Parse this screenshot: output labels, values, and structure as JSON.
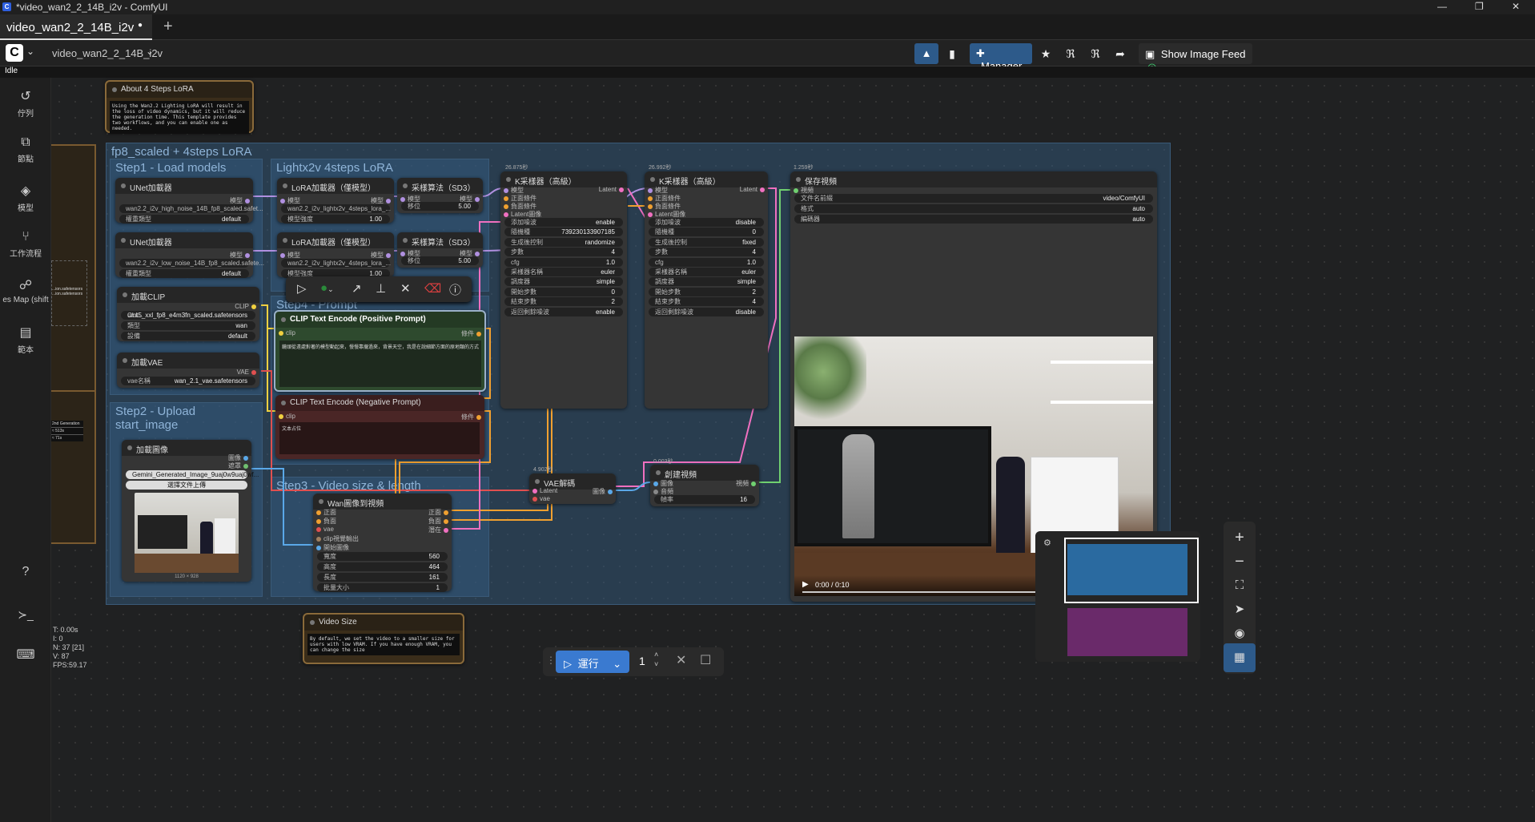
{
  "window": {
    "title": "*video_wan2_2_14B_i2v - ComfyUI",
    "min": "—",
    "max": "❐",
    "close": "✕"
  },
  "tabs": [
    {
      "label": "video_wan2_2_14B_i2v",
      "dot": "●"
    }
  ],
  "tab_add": "+",
  "toolbar": {
    "workflow_name": "video_wan2_2_14B_i2v",
    "manager": "Manager",
    "show_image_feed": "Show Image Feed"
  },
  "status": "Idle",
  "sidebar": [
    {
      "icon": "history-icon",
      "glyph": "↺",
      "label": "佇列"
    },
    {
      "icon": "node-icon",
      "glyph": "⧉",
      "label": "節點"
    },
    {
      "icon": "model-icon",
      "glyph": "◈",
      "label": "模型"
    },
    {
      "icon": "workflow-icon",
      "glyph": "⑂",
      "label": "工作流程"
    },
    {
      "icon": "map-icon",
      "glyph": "☍",
      "label": "es Map (shift"
    },
    {
      "icon": "template-icon",
      "glyph": "▤",
      "label": "範本"
    }
  ],
  "sidebar_bottom": {
    "help": "?",
    "terminal": "≻_",
    "keyboard": "⌨"
  },
  "stats": [
    "T: 0.00s",
    "I: 0",
    "N: 37 [21]",
    "V: 87",
    "FPS:59.17"
  ],
  "notes": {
    "about": {
      "title": "About 4 Steps LoRA",
      "text": "Using the Wan2.2 Lighting LoRA will result in the loss of video dynamics, but it will reduce the generation time. This template provides two workflows, and you can enable one as needed."
    },
    "video_size": {
      "title": "Video Size",
      "text": "By default, we set the video to a smaller size for users with low VRAM. If you have enough VRAM, you can change the size"
    }
  },
  "partial_left": {
    "line1": "...ion.safetensors",
    "line2": "...ion.safetensors",
    "table_header": "2nd Generation",
    "row1": "≈ 513s",
    "row2": "≈ 71s"
  },
  "groups": {
    "main": "fp8_scaled + 4steps LoRA",
    "step1": "Step1 - Load models",
    "lightx": "Lightx2v 4steps LoRA",
    "step4": "Step4 - Prompt",
    "step2": "Step2 - Upload start_image",
    "step3": "Step3 - Video size & length"
  },
  "nodes": {
    "unet1": {
      "title": "UNet加載器",
      "out": "模型",
      "w1": "wan2.2_i2v_high_noise_14B_fp8_scaled.safet...",
      "w2k": "權重類型",
      "w2v": "default"
    },
    "unet2": {
      "title": "UNet加載器",
      "out": "模型",
      "w1": "wan2.2_i2v_low_noise_14B_fp8_scaled.safete...",
      "w2k": "權重類型",
      "w2v": "default"
    },
    "clip": {
      "title": "加載CLIP",
      "out": "CLIP",
      "w1k": "CLI...",
      "w1v": "umt5_xxl_fp8_e4m3fn_scaled.safetensors",
      "w2k": "類型",
      "w2v": "wan",
      "w3k": "設備",
      "w3v": "default"
    },
    "vae": {
      "title": "加載VAE",
      "out": "VAE",
      "w1k": "vae名稱",
      "w1v": "wan_2.1_vae.safetensors"
    },
    "lora1": {
      "title": "LoRA加載器（僅模型）",
      "in": "模型",
      "out": "模型",
      "w1": "wan2.2_i2v_lightx2v_4steps_lora_...",
      "w2k": "模型強度",
      "w2v": "1.00"
    },
    "lora2": {
      "title": "LoRA加載器（僅模型）",
      "in": "模型",
      "out": "模型",
      "w1": "wan2.2_i2v_lightx2v_4steps_lora_...",
      "w2k": "模型強度",
      "w2v": "1.00"
    },
    "sd3a": {
      "title": "采樣算法（SD3）",
      "in": "模型",
      "out": "模型",
      "wk": "移位",
      "wv": "5.00"
    },
    "sd3b": {
      "title": "采樣算法（SD3）",
      "in": "模型",
      "out": "模型",
      "wk": "移位",
      "wv": "5.00"
    },
    "pos": {
      "title": "CLIP Text Encode (Positive Prompt)",
      "in": "clip",
      "out": "條件",
      "text": "鏡頭從遠處對著的模型動起來，慢慢靠攏過來，背景天空，我是在說細節方面的原地類的方式"
    },
    "neg": {
      "title": "CLIP Text Encode (Negative Prompt)",
      "in": "clip",
      "out": "條件",
      "text": "文本占位"
    },
    "loadimg": {
      "title": "加載圖像",
      "out1": "圖像",
      "out2": "遮罩",
      "file": "Gemini_Generated_Image_9uaj0w9uaj0wf...",
      "upload": "選擇文件上傳",
      "size": "1120 × 928"
    },
    "wanimg": {
      "title": "Wan圖像到視頻",
      "in": [
        "正面",
        "負面",
        "vae",
        "clip視覺輸出",
        "開始圖像"
      ],
      "out": [
        "正面",
        "負面",
        "潛在"
      ],
      "w": [
        {
          "k": "寬度",
          "v": "560"
        },
        {
          "k": "高度",
          "v": "464"
        },
        {
          "k": "長度",
          "v": "161"
        },
        {
          "k": "批量大小",
          "v": "1"
        }
      ]
    },
    "k1": {
      "time": "26.875秒",
      "title": "K采樣器（高級）",
      "in": [
        "模型",
        "正面條件",
        "負面條件",
        "Latent圖像"
      ],
      "out": "Latent",
      "w": [
        {
          "k": "添加噪波",
          "v": "enable"
        },
        {
          "k": "隨機種",
          "v": "739230133907185"
        },
        {
          "k": "生成後控制",
          "v": "randomize"
        },
        {
          "k": "步數",
          "v": "4"
        },
        {
          "k": "cfg",
          "v": "1.0"
        },
        {
          "k": "采樣器名稱",
          "v": "euler"
        },
        {
          "k": "調度器",
          "v": "simple"
        },
        {
          "k": "開始步數",
          "v": "0"
        },
        {
          "k": "結束步數",
          "v": "2"
        },
        {
          "k": "返回剩餘噪波",
          "v": "enable"
        }
      ]
    },
    "k2": {
      "time": "26.992秒",
      "title": "K采樣器（高級）",
      "in": [
        "模型",
        "正面條件",
        "負面條件",
        "Latent圖像"
      ],
      "out": "Latent",
      "w": [
        {
          "k": "添加噪波",
          "v": "disable"
        },
        {
          "k": "隨機種",
          "v": "0"
        },
        {
          "k": "生成後控制",
          "v": "fixed"
        },
        {
          "k": "步數",
          "v": "4"
        },
        {
          "k": "cfg",
          "v": "1.0"
        },
        {
          "k": "采樣器名稱",
          "v": "euler"
        },
        {
          "k": "調度器",
          "v": "simple"
        },
        {
          "k": "開始步數",
          "v": "2"
        },
        {
          "k": "結束步數",
          "v": "4"
        },
        {
          "k": "返回剩餘噪波",
          "v": "disable"
        }
      ]
    },
    "vaedec": {
      "time": "4.902秒",
      "title": "VAE解碼",
      "in1": "Latent",
      "in2": "vae",
      "out": "圖像"
    },
    "createvid": {
      "time": "0.003秒",
      "title": "創建視頻",
      "in1": "圖像",
      "in2": "音頻",
      "out": "視頻",
      "wk": "幀率",
      "wv": "16"
    },
    "savevid": {
      "time": "1.259秒",
      "title": "保存視頻",
      "in": "視頻",
      "w": [
        {
          "k": "文件名前綴",
          "v": "video/ComfyUI"
        },
        {
          "k": "格式",
          "v": "auto"
        },
        {
          "k": "編碼器",
          "v": "auto"
        }
      ],
      "player_time": "0:00 / 0:10"
    }
  },
  "run": {
    "label": "運行",
    "count": "1"
  },
  "colors": {
    "accent": "#2d5a8a",
    "group": "#2e5a80",
    "pink": "#e878c8",
    "yellow": "#f0b040",
    "purple": "#b090e0",
    "blue": "#5aa8e8",
    "green": "#70d070"
  }
}
